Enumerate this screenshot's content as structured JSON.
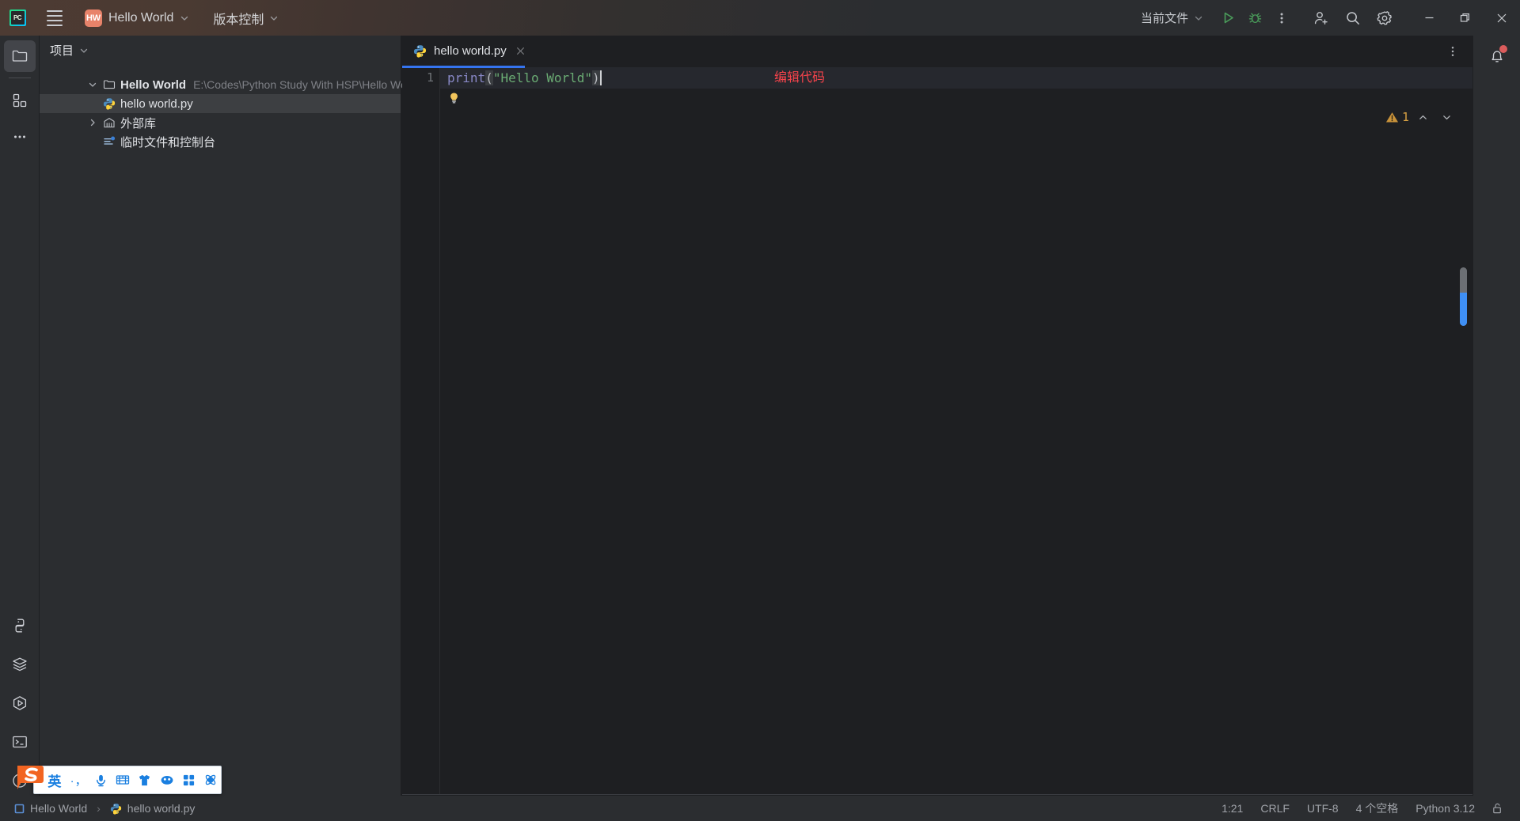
{
  "titlebar": {
    "app_icon": "pycharm-logo",
    "app_icon_text": "PC",
    "menu_icon": "hamburger-menu-icon",
    "project_badge": "HW",
    "project_name": "Hello World",
    "vcs_label": "版本控制",
    "run_config_label": "当前文件",
    "run_icon": "run-icon",
    "debug_icon": "debug-icon",
    "more_icon": "more-vertical-icon",
    "account_icon": "add-user-icon",
    "search_icon": "search-icon",
    "settings_icon": "gear-icon",
    "minimize_icon": "minimize-icon",
    "maximize_icon": "restore-icon",
    "close_icon": "close-icon",
    "accent_badge_color": "#e8836a"
  },
  "left_rail": {
    "top_items": [
      {
        "name": "project-tool-window",
        "icon": "folder-icon",
        "active": true
      },
      {
        "name": "commit-tool-window",
        "icon": "squares-icon",
        "active": false
      },
      {
        "name": "more-tool-windows",
        "icon": "ellipsis-icon",
        "active": false
      }
    ],
    "bottom_items": [
      {
        "name": "python-console",
        "icon": "python-icon"
      },
      {
        "name": "database",
        "icon": "layers-icon"
      },
      {
        "name": "run-tool-window",
        "icon": "run-hexagon-icon"
      },
      {
        "name": "terminal-tool-window",
        "icon": "terminal-icon"
      },
      {
        "name": "problems-tool-window",
        "icon": "warning-circle-icon"
      }
    ]
  },
  "project_panel": {
    "header_title": "项目",
    "header_chevron": "chevron-down-icon",
    "tree": [
      {
        "label": "Hello World",
        "path": "E:\\Codes\\Python Study With HSP\\Hello World",
        "icon": "folder-icon",
        "twisty": "chevron-down-icon",
        "bold": true,
        "selected": false
      },
      {
        "label": "hello world.py",
        "path": "",
        "icon": "python-file-icon",
        "twisty": "",
        "bold": false,
        "selected": true
      },
      {
        "label": "外部库",
        "path": "",
        "icon": "library-icon",
        "twisty": "chevron-right-icon",
        "bold": false,
        "selected": false
      },
      {
        "label": "临时文件和控制台",
        "path": "",
        "icon": "scratches-icon",
        "twisty": "",
        "bold": false,
        "selected": false
      }
    ]
  },
  "editor": {
    "tab": {
      "label": "hello world.py",
      "icon": "python-file-icon",
      "close_icon": "close-icon"
    },
    "tabbar_options_icon": "more-vertical-icon",
    "line_number": "1",
    "code": {
      "fn": "print",
      "open_paren": "(",
      "string": "\"Hello World\"",
      "close_paren": ")"
    },
    "annotation": "编辑代码",
    "annotation_color": "#f5434b",
    "intention_bulb_icon": "lightbulb-icon",
    "inspection": {
      "warning_icon": "warning-triangle-icon",
      "count": "1",
      "prev_icon": "chevron-up-icon",
      "next_icon": "chevron-down-icon"
    },
    "scroll_marker": "scrollbar-thumb"
  },
  "right_rail": {
    "notifications_icon": "bell-icon",
    "has_notification_dot": true
  },
  "statusbar": {
    "breadcrumbs": [
      {
        "label": "Hello World",
        "icon": "module-icon"
      },
      {
        "label": "hello world.py",
        "icon": "python-file-icon"
      }
    ],
    "separator": "›",
    "caret_position": "1:21",
    "line_separator": "CRLF",
    "encoding": "UTF-8",
    "indent": "4 个空格",
    "interpreter": "Python 3.12",
    "lock_icon": "unlock-icon"
  },
  "ime": {
    "name": "sogou-input-method",
    "logo": "sogou-s-logo",
    "lang_label": "英",
    "punctuation_label": "·，",
    "buttons": [
      {
        "name": "ime-language-toggle",
        "icon": "text-英"
      },
      {
        "name": "ime-punctuation-toggle",
        "icon": "punctuation-icon"
      },
      {
        "name": "ime-voice-input",
        "icon": "microphone-icon"
      },
      {
        "name": "ime-soft-keyboard",
        "icon": "keyboard-icon"
      },
      {
        "name": "ime-skin",
        "icon": "shirt-icon"
      },
      {
        "name": "ime-emoji",
        "icon": "emoji-icon"
      },
      {
        "name": "ime-toolbox",
        "icon": "grid-icon"
      },
      {
        "name": "ime-settings",
        "icon": "settings-icon"
      }
    ]
  }
}
